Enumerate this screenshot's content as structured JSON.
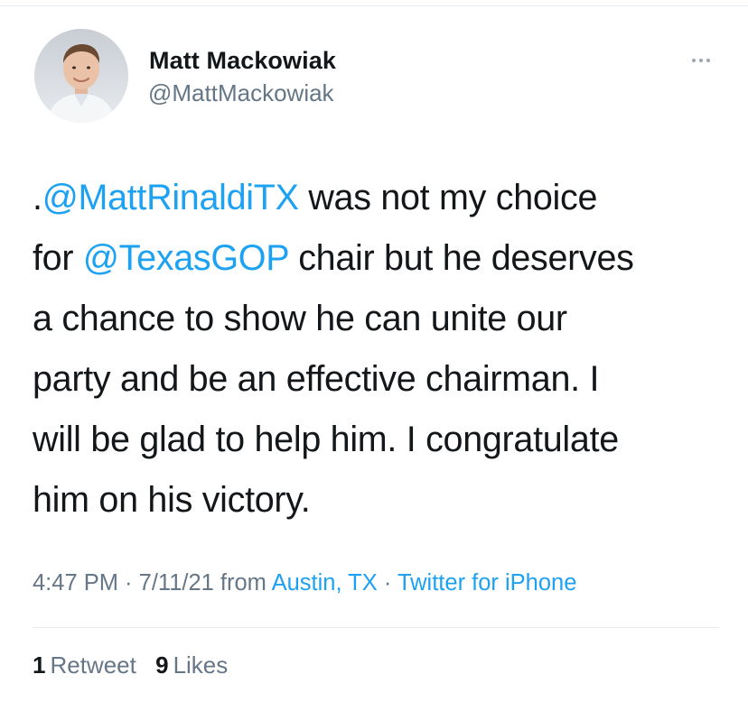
{
  "tweet": {
    "author": {
      "name": "Matt Mackowiak",
      "handle": "@MattMackowiak",
      "avatar_icon": "profile-photo"
    },
    "more_icon": "ellipsis-icon",
    "text_lines": [
      [
        {
          "text": ".",
          "type": "text"
        },
        {
          "text": "@MattRinaldiTX",
          "type": "mention"
        },
        {
          "text": " was not my choice",
          "type": "text"
        }
      ],
      [
        {
          "text": "for ",
          "type": "text"
        },
        {
          "text": "@TexasGOP",
          "type": "mention"
        },
        {
          "text": " chair but he deserves",
          "type": "text"
        }
      ],
      [
        {
          "text": "a chance to show he can unite our",
          "type": "text"
        }
      ],
      [
        {
          "text": "party and be an effective chairman. I",
          "type": "text"
        }
      ],
      [
        {
          "text": "will be glad to help him. I congratulate",
          "type": "text"
        }
      ],
      [
        {
          "text": "him on his victory.",
          "type": "text"
        }
      ]
    ],
    "meta": {
      "time": "4:47 PM",
      "separator": " · ",
      "date": "7/11/21",
      "from_label": " from ",
      "location": "Austin, TX",
      "source": "Twitter for iPhone"
    },
    "stats": {
      "retweet_count": "1",
      "retweet_label": "Retweet",
      "like_count": "9",
      "like_label": "Likes"
    }
  },
  "colors": {
    "link": "#1da1f2",
    "secondary_text": "#657786",
    "primary_text": "#14171a",
    "divider": "#e6ecf0"
  }
}
